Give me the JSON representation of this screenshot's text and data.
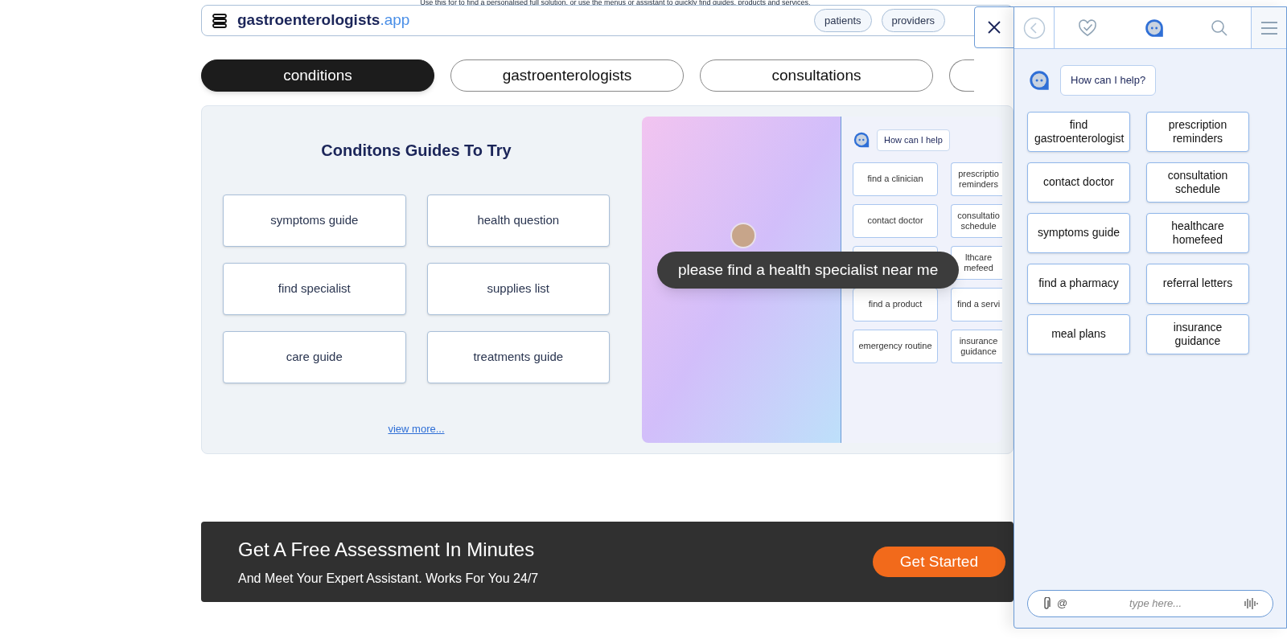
{
  "top_note": "Use this for to find a personalised full solution, or use the menus or assistant to quickly find guides, products and services.",
  "header": {
    "brand": "gastroenterologists",
    "brand_suffix": ".app",
    "links": [
      "patients",
      "providers"
    ]
  },
  "tabs": [
    {
      "label": "conditions",
      "selected": true
    },
    {
      "label": "gastroenterologists",
      "selected": false
    },
    {
      "label": "consultations",
      "selected": false
    },
    {
      "selected": false
    }
  ],
  "guides": {
    "title": "Conditons Guides To Try",
    "items": [
      "symptoms guide",
      "health question",
      "find specialist",
      "supplies list",
      "care guide",
      "treatments guide"
    ],
    "more": "view more..."
  },
  "demo": {
    "greeting": "How can I help",
    "caption": "please find a health specialist near me",
    "options": [
      {
        "kind": "option",
        "label": "find a clinician"
      },
      {
        "kind": "option",
        "label": "prescriptio reminders"
      },
      {
        "kind": "option",
        "label": "contact doctor"
      },
      {
        "kind": "option",
        "label": "consultatio schedule"
      },
      {
        "kind": "covered"
      },
      {
        "kind": "option",
        "label": "lthcare mefeed"
      },
      {
        "kind": "option",
        "label": "find a product"
      },
      {
        "kind": "option",
        "label": "find a servi"
      },
      {
        "kind": "option",
        "label": "emergency routine"
      },
      {
        "kind": "option",
        "label": "insurance guidance"
      }
    ]
  },
  "banner": {
    "title": "Get A Free Assessment In Minutes",
    "subtitle": "And Meet Your Expert Assistant. Works For You 24/7",
    "button": "Get Started"
  },
  "assistant": {
    "greeting": "How can I help?",
    "options": [
      "find gastroenterologist",
      "prescription reminders",
      "contact doctor",
      "consultation schedule",
      "symptoms guide",
      "healthcare homefeed",
      "find a pharmacy",
      "referral letters",
      "meal plans",
      "insurance guidance"
    ],
    "input": {
      "placeholder": "type here..."
    },
    "at_sign": "@"
  }
}
